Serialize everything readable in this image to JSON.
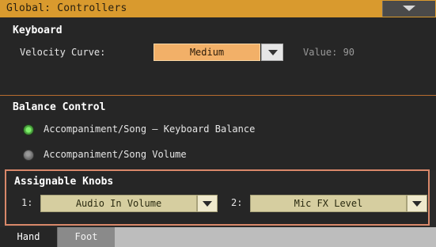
{
  "window": {
    "title": "Global: Controllers"
  },
  "keyboard": {
    "title": "Keyboard",
    "velocity_label": "Velocity Curve:",
    "velocity_value": "Medium",
    "value_readout": "Value: 90"
  },
  "balance": {
    "title": "Balance Control",
    "options": [
      {
        "label": "Accompaniment/Song – Keyboard Balance",
        "selected": true
      },
      {
        "label": "Accompaniment/Song Volume",
        "selected": false
      }
    ]
  },
  "knobs": {
    "title": "Assignable Knobs",
    "knob1": {
      "label": "1:",
      "value": "Audio In Volume"
    },
    "knob2": {
      "label": "2:",
      "value": "Mic FX Level"
    }
  },
  "tabs": [
    {
      "label": "Hand",
      "active": true
    },
    {
      "label": "Foot",
      "active": false
    }
  ],
  "colors": {
    "title_bar": "#d99a2e",
    "selected_dropdown": "#f2b068",
    "focus_border": "#d9886a",
    "radio_on": "#52b044"
  }
}
